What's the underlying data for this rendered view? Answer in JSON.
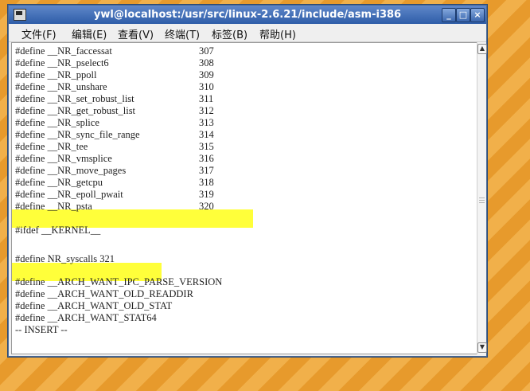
{
  "window": {
    "title": "ywl@localhost:/usr/src/linux-2.6.21/include/asm-i386",
    "controls": {
      "minimize": "_",
      "maximize": "□",
      "close": "×"
    }
  },
  "menu": [
    "文件(F)",
    "编辑(E)",
    "查看(V)",
    "终端(T)",
    "标签(B)",
    "帮助(H)"
  ],
  "lines": [
    {
      "text": "#define __NR_faccessat",
      "num": "307"
    },
    {
      "text": "#define __NR_pselect6",
      "num": "308"
    },
    {
      "text": "#define __NR_ppoll",
      "num": "309"
    },
    {
      "text": "#define __NR_unshare",
      "num": "310"
    },
    {
      "text": "#define __NR_set_robust_list",
      "num": "311"
    },
    {
      "text": "#define __NR_get_robust_list",
      "num": "312"
    },
    {
      "text": "#define __NR_splice",
      "num": "313"
    },
    {
      "text": "#define __NR_sync_file_range",
      "num": "314"
    },
    {
      "text": "#define __NR_tee",
      "num": "315"
    },
    {
      "text": "#define __NR_vmsplice",
      "num": "316"
    },
    {
      "text": "#define __NR_move_pages",
      "num": "317"
    },
    {
      "text": "#define __NR_getcpu",
      "num": "318"
    },
    {
      "text": "#define __NR_epoll_pwait",
      "num": "319"
    },
    {
      "text": "#define __NR_psta",
      "num": "320"
    },
    {
      "text": "",
      "num": ""
    },
    {
      "text": "#ifdef __KERNEL__",
      "num": ""
    },
    {
      "text": "",
      "num": ""
    },
    {
      "text": "#define NR_syscalls 321",
      "num": ""
    },
    {
      "text": "",
      "num": ""
    },
    {
      "text": "#define __ARCH_WANT_IPC_PARSE_VERSION",
      "num": ""
    },
    {
      "text": "#define __ARCH_WANT_OLD_READDIR",
      "num": ""
    },
    {
      "text": "#define __ARCH_WANT_OLD_STAT",
      "num": ""
    },
    {
      "text": "#define __ARCH_WANT_STAT64",
      "num": ""
    },
    {
      "text": "-- INSERT --",
      "num": ""
    }
  ],
  "highlight_color": "#ffff3a",
  "background_color": "#e79a2c"
}
